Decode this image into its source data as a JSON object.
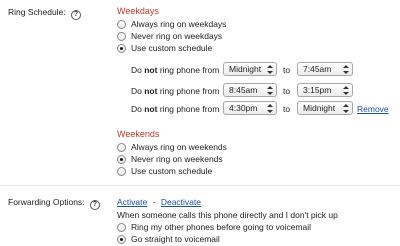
{
  "ring_schedule": {
    "label": "Ring Schedule:",
    "help_glyph": "?",
    "weekdays": {
      "heading": "Weekdays",
      "options": [
        {
          "label": "Always ring on weekdays",
          "checked": false
        },
        {
          "label": "Never ring on weekdays",
          "checked": false
        },
        {
          "label": "Use custom schedule",
          "checked": true
        }
      ],
      "rows": [
        {
          "prefix": "Do ",
          "bold": "not",
          "suffix": " ring phone from",
          "from": "Midnight",
          "to_label": "to",
          "to": "7:45am",
          "remove": ""
        },
        {
          "prefix": "Do ",
          "bold": "not",
          "suffix": " ring phone from",
          "from": "8:45am",
          "to_label": "to",
          "to": "3:15pm",
          "remove": ""
        },
        {
          "prefix": "Do ",
          "bold": "not",
          "suffix": " ring phone from",
          "from": "4:30pm",
          "to_label": "to",
          "to": "Midnight",
          "remove": "Remove"
        }
      ]
    },
    "weekends": {
      "heading": "Weekends",
      "options": [
        {
          "label": "Always ring on weekends",
          "checked": false
        },
        {
          "label": "Never ring on weekends",
          "checked": true
        },
        {
          "label": "Use custom schedule",
          "checked": false
        }
      ]
    }
  },
  "forwarding": {
    "label": "Forwarding Options:",
    "help_glyph": "?",
    "activate": "Activate",
    "separator": "-",
    "deactivate": "Deactivate",
    "description": "When someone calls this phone directly and I don't pick up",
    "options": [
      {
        "label": "Ring my other phones before going to voicemail",
        "checked": false
      },
      {
        "label": "Go straight to voicemail",
        "checked": true
      }
    ]
  }
}
